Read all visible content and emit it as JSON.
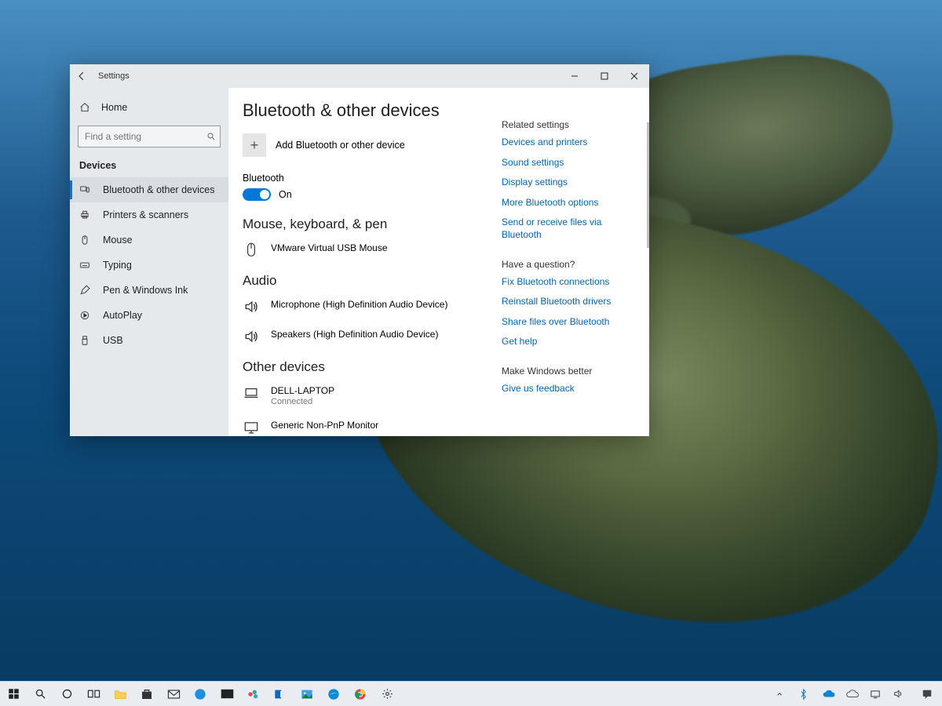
{
  "window": {
    "title": "Settings",
    "back_tooltip": "Back"
  },
  "sidebar": {
    "home": "Home",
    "search_placeholder": "Find a setting",
    "section": "Devices",
    "items": [
      {
        "icon": "devices-icon",
        "label": "Bluetooth & other devices",
        "active": true
      },
      {
        "icon": "printer-icon",
        "label": "Printers & scanners",
        "active": false
      },
      {
        "icon": "mouse-icon",
        "label": "Mouse",
        "active": false
      },
      {
        "icon": "keyboard-icon",
        "label": "Typing",
        "active": false
      },
      {
        "icon": "pen-icon",
        "label": "Pen & Windows Ink",
        "active": false
      },
      {
        "icon": "autoplay-icon",
        "label": "AutoPlay",
        "active": false
      },
      {
        "icon": "usb-icon",
        "label": "USB",
        "active": false
      }
    ]
  },
  "page": {
    "title": "Bluetooth & other devices",
    "add_label": "Add Bluetooth or other device",
    "bt_label": "Bluetooth",
    "bt_state": "On",
    "sections": {
      "mouse": {
        "title": "Mouse, keyboard, & pen",
        "items": [
          {
            "name": "VMware Virtual USB Mouse",
            "sub": ""
          }
        ]
      },
      "audio": {
        "title": "Audio",
        "items": [
          {
            "name": "Microphone (High Definition Audio Device)",
            "sub": ""
          },
          {
            "name": "Speakers (High Definition Audio Device)",
            "sub": ""
          }
        ]
      },
      "other": {
        "title": "Other devices",
        "items": [
          {
            "name": "DELL-LAPTOP",
            "sub": "Connected"
          },
          {
            "name": "Generic Non-PnP Monitor",
            "sub": ""
          }
        ]
      }
    }
  },
  "sidepanel": {
    "related": {
      "head": "Related settings",
      "links": [
        "Devices and printers",
        "Sound settings",
        "Display settings",
        "More Bluetooth options",
        "Send or receive files via Bluetooth"
      ]
    },
    "question": {
      "head": "Have a question?",
      "links": [
        "Fix Bluetooth connections",
        "Reinstall Bluetooth drivers",
        "Share files over Bluetooth",
        "Get help"
      ]
    },
    "feedback": {
      "head": "Make Windows better",
      "links": [
        "Give us feedback"
      ]
    }
  },
  "colors": {
    "accent": "#0078d7",
    "link": "#0066b4"
  }
}
